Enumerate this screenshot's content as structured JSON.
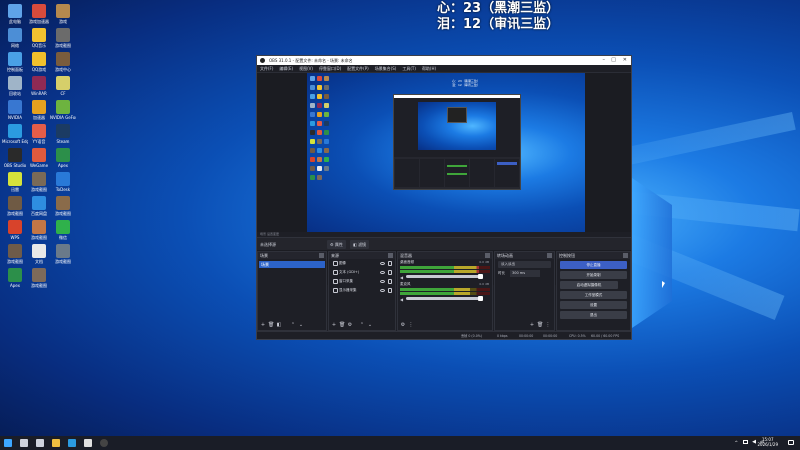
{
  "overlay": {
    "line1": "心：23（黑潮三监）",
    "line2": "泪：12（审讯三监）"
  },
  "desktop_icons": [
    {
      "label": "此电脑",
      "color": "#5fa3e8"
    },
    {
      "label": "游戏加速器",
      "color": "#d84b3c"
    },
    {
      "label": "游戏",
      "color": "#b5894e"
    },
    {
      "label": "网络",
      "color": "#4c8ed6"
    },
    {
      "label": "QQ音乐",
      "color": "#f2c230"
    },
    {
      "label": "游戏截图",
      "color": "#6b6b6b"
    },
    {
      "label": "控制面板",
      "color": "#4aa0e6"
    },
    {
      "label": "QQ游戏",
      "color": "#f1c02c"
    },
    {
      "label": "游戏中心",
      "color": "#7a5c3d"
    },
    {
      "label": "回收站",
      "color": "#9fb4c8"
    },
    {
      "label": "WinRAR",
      "color": "#8f2a54"
    },
    {
      "label": "CF",
      "color": "#d6cf6a"
    },
    {
      "label": "NVIDIA",
      "color": "#3877d1"
    },
    {
      "label": "加速器",
      "color": "#e6a11f"
    },
    {
      "label": "NVIDIA GeForce",
      "color": "#6db33f"
    },
    {
      "label": "Microsoft Edge",
      "color": "#2b9be0"
    },
    {
      "label": "YY语音",
      "color": "#e45d49"
    },
    {
      "label": "Steam",
      "color": "#1b3b63"
    },
    {
      "label": "OBS Studio",
      "color": "#2a2a2a"
    },
    {
      "label": "WeGame",
      "color": "#e05a3e"
    },
    {
      "label": "Apex",
      "color": "#2c8f4a"
    },
    {
      "label": "迅雷",
      "color": "#d5e23b"
    },
    {
      "label": "游戏截图",
      "color": "#7a6a57"
    },
    {
      "label": "ToDesk",
      "color": "#2979d8"
    },
    {
      "label": "游戏截图",
      "color": "#6f5a44"
    },
    {
      "label": "百度网盘",
      "color": "#2e8de0"
    },
    {
      "label": "游戏截图",
      "color": "#8a6b4a"
    },
    {
      "label": "WPS",
      "color": "#d8432b"
    },
    {
      "label": "游戏截图",
      "color": "#c37646"
    },
    {
      "label": "微信",
      "color": "#2fb14b"
    },
    {
      "label": "游戏截图",
      "color": "#6e5b4a"
    },
    {
      "label": "文档",
      "color": "#e8e8e8"
    },
    {
      "label": "游戏截图",
      "color": "#6a7a8a"
    },
    {
      "label": "Apex",
      "color": "#2c8f4a"
    },
    {
      "label": "游戏截图",
      "color": "#7d6a5a"
    }
  ],
  "obs": {
    "title": "OBS 31.0.1 - 配置文件: 未命名 - 场景: 未命名",
    "menu": [
      "文件(F)",
      "编辑(E)",
      "视图(V)",
      "停靠窗口(D)",
      "配置文件(P)",
      "场景集合(S)",
      "工具(T)",
      "帮助(H)"
    ],
    "scene_bar_label": "场景  设置变更",
    "context": {
      "no_source": "未选择源",
      "properties": "属性",
      "filters": "滤镜"
    },
    "scenes": {
      "title": "场景",
      "items": [
        "场景"
      ]
    },
    "sources": {
      "title": "来源",
      "items": [
        {
          "label": "图像",
          "icon": "image-icon"
        },
        {
          "label": "文本 (GDI+)",
          "icon": "text-icon"
        },
        {
          "label": "窗口采集",
          "icon": "window-icon"
        },
        {
          "label": "显示器采集",
          "icon": "monitor-icon"
        }
      ]
    },
    "mixer": {
      "title": "混音器",
      "tracks": [
        {
          "label": "桌面音频",
          "db": "0.0 dB",
          "level": 0.88
        },
        {
          "label": "麦克风",
          "db": "0.0 dB",
          "level": 0.78
        }
      ]
    },
    "transitions": {
      "title": "转场动画",
      "type": "淡入淡出",
      "duration_label": "时长",
      "duration": "300 ms"
    },
    "controls": {
      "title": "控制按钮",
      "buttons": [
        "停止直播",
        "开始录制",
        "启动虚拟摄像机",
        "工作室模式",
        "设置",
        "退出"
      ]
    },
    "status": {
      "dropped": "丢帧 0 (0.0%)",
      "bitrate": "0 kbps",
      "stream_time": "00:00:00",
      "rec_time": "00:00:00",
      "cpu": "CPU: 0.5%",
      "fps": "60.00 / 60.00 FPS"
    }
  },
  "taskbar": {
    "time": "15:07",
    "date": "2026/1/29",
    "ime": "中",
    "icons": [
      "windows-start-icon",
      "search-icon",
      "task-view-icon",
      "file-explorer-icon",
      "edge-icon",
      "chrome-icon",
      "obs-icon"
    ]
  }
}
